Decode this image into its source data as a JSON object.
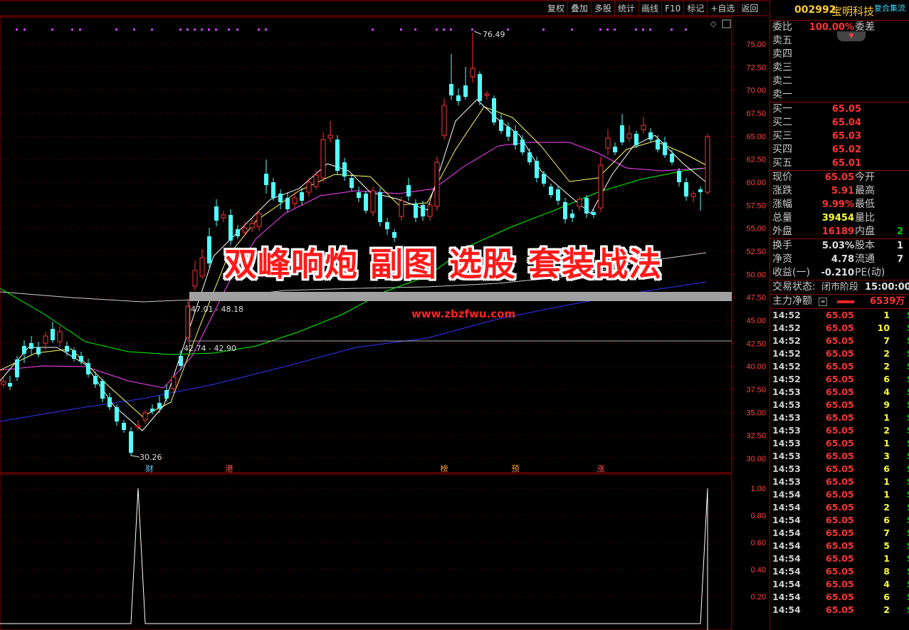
{
  "toolbar": {
    "buttons": [
      "复权",
      "叠加",
      "多股",
      "统计",
      "画线",
      "F10",
      "标记",
      "+自选",
      "返回"
    ]
  },
  "stock": {
    "code": "002992",
    "name": "宝明科技",
    "tag": "复合集流"
  },
  "order_book": {
    "weibi_label": "委比",
    "weibi_value": "100.00%",
    "weicha_label": "委差",
    "sell": [
      {
        "label": "卖五",
        "price": ""
      },
      {
        "label": "卖四",
        "price": ""
      },
      {
        "label": "卖三",
        "price": ""
      },
      {
        "label": "卖二",
        "price": ""
      },
      {
        "label": "卖一",
        "price": ""
      }
    ],
    "buy": [
      {
        "label": "买一",
        "price": "65.05"
      },
      {
        "label": "买二",
        "price": "65.04"
      },
      {
        "label": "买三",
        "price": "65.03"
      },
      {
        "label": "买四",
        "price": "65.02"
      },
      {
        "label": "买五",
        "price": "65.01"
      }
    ]
  },
  "quote": [
    {
      "l1": "现价",
      "v1": "65.05",
      "c1": "#ff3333",
      "l2": "今开",
      "v2": ""
    },
    {
      "l1": "涨跌",
      "v1": "5.91",
      "c1": "#ff3333",
      "l2": "最高",
      "v2": ""
    },
    {
      "l1": "涨幅",
      "v1": "9.99%",
      "c1": "#ff3333",
      "l2": "最低",
      "v2": ""
    },
    {
      "l1": "总量",
      "v1": "39454",
      "c1": "#ffff33",
      "l2": "量比",
      "v2": ""
    },
    {
      "l1": "外盘",
      "v1": "16189",
      "c1": "#ff3333",
      "l2": "内盘",
      "v2": "2"
    }
  ],
  "fund": [
    {
      "l1": "换手",
      "v1": "5.03%",
      "l2": "股本",
      "v2": "1"
    },
    {
      "l1": "净资",
      "v1": "4.78",
      "l2": "流通",
      "v2": "7"
    },
    {
      "l1": "收益(一)",
      "v1": "-0.210",
      "l2": "PE(动)",
      "v2": ""
    }
  ],
  "status": {
    "label": "交易状态:",
    "value": "闭市阶段",
    "time": "15:00:00"
  },
  "flow": {
    "label": "主力净额",
    "value": "6539万"
  },
  "trades": [
    {
      "t": "14:52",
      "p": "65.05",
      "v": "1",
      "c": "#ffff33",
      "x": "S"
    },
    {
      "t": "14:52",
      "p": "65.05",
      "v": "10",
      "c": "#ffff33",
      "x": "S"
    },
    {
      "t": "14:52",
      "p": "65.05",
      "v": "7",
      "c": "#ffff33",
      "x": "S"
    },
    {
      "t": "14:52",
      "p": "65.05",
      "v": "2",
      "c": "#ffff33",
      "x": "S"
    },
    {
      "t": "14:52",
      "p": "65.05",
      "v": "2",
      "c": "#ffff33",
      "x": "S"
    },
    {
      "t": "14:52",
      "p": "65.05",
      "v": "6",
      "c": "#ffff33",
      "x": "S"
    },
    {
      "t": "14:53",
      "p": "65.05",
      "v": "4",
      "c": "#ffff33",
      "x": "S"
    },
    {
      "t": "14:53",
      "p": "65.05",
      "v": "9",
      "c": "#ffff33",
      "x": "S"
    },
    {
      "t": "14:53",
      "p": "65.05",
      "v": "1",
      "c": "#ffff33",
      "x": "S"
    },
    {
      "t": "14:53",
      "p": "65.05",
      "v": "2",
      "c": "#ffff33",
      "x": "S"
    },
    {
      "t": "14:53",
      "p": "65.05",
      "v": "1",
      "c": "#ffff33",
      "x": "S"
    },
    {
      "t": "14:53",
      "p": "65.05",
      "v": "3",
      "c": "#ffff33",
      "x": "S"
    },
    {
      "t": "14:53",
      "p": "65.05",
      "v": "6",
      "c": "#ffff33",
      "x": "S"
    },
    {
      "t": "14:53",
      "p": "65.05",
      "v": "1",
      "c": "#ffff33",
      "x": "S"
    },
    {
      "t": "14:54",
      "p": "65.05",
      "v": "1",
      "c": "#ffff33",
      "x": "S"
    },
    {
      "t": "14:54",
      "p": "65.05",
      "v": "2",
      "c": "#ffff33",
      "x": "S"
    },
    {
      "t": "14:54",
      "p": "65.05",
      "v": "6",
      "c": "#ffff33",
      "x": "S"
    },
    {
      "t": "14:54",
      "p": "65.05",
      "v": "7",
      "c": "#ffff33",
      "x": "S"
    },
    {
      "t": "14:54",
      "p": "65.05",
      "v": "5",
      "c": "#ffff33",
      "x": "S"
    },
    {
      "t": "14:54",
      "p": "65.05",
      "v": "1",
      "c": "#ffff33",
      "x": "S"
    },
    {
      "t": "14:54",
      "p": "65.05",
      "v": "8",
      "c": "#ffff33",
      "x": "S"
    },
    {
      "t": "14:54",
      "p": "65.05",
      "v": "4",
      "c": "#ffff33",
      "x": "S"
    },
    {
      "t": "14:54",
      "p": "65.05",
      "v": "6",
      "c": "#ffff33",
      "x": "S"
    },
    {
      "t": "14:54",
      "p": "65.05",
      "v": "2",
      "c": "#ffff33",
      "x": "S"
    }
  ],
  "overlay": {
    "banner": "双峰响炮 副图 选股 套装战法",
    "url": "www.zbzfwu.com"
  },
  "price_axis": [
    "75.00",
    "72.50",
    "70.00",
    "67.50",
    "65.00",
    "62.50",
    "60.00",
    "57.50",
    "55.00",
    "52.50",
    "50.00",
    "47.50",
    "45.00",
    "42.50",
    "40.00",
    "37.50",
    "35.00",
    "32.50",
    "30.00"
  ],
  "sub_axis": [
    "1.00",
    "0.80",
    "0.60",
    "0.40",
    "0.20"
  ],
  "annotations": {
    "high": "76.49",
    "low": "30.26",
    "box1": "47.01 - 48.18",
    "box2": "42.74 - 42.90"
  },
  "event_markers": [
    {
      "text": "财",
      "color": "#66ccff"
    },
    {
      "text": "港",
      "color": "#ff5555"
    },
    {
      "text": "榜",
      "color": "#ff9933"
    },
    {
      "text": "预",
      "color": "#ff9933"
    },
    {
      "text": "涨",
      "color": "#ff5555"
    }
  ],
  "colors": {
    "up": "#ff3333",
    "down": "#54ffff",
    "ma5": "#ffffff",
    "ma10": "#ffff66",
    "ma20": "#ff44ff",
    "ma60": "#00ff00",
    "ma120": "#cccccc",
    "ma250": "#3333ff",
    "grid": "#7a0000"
  }
}
